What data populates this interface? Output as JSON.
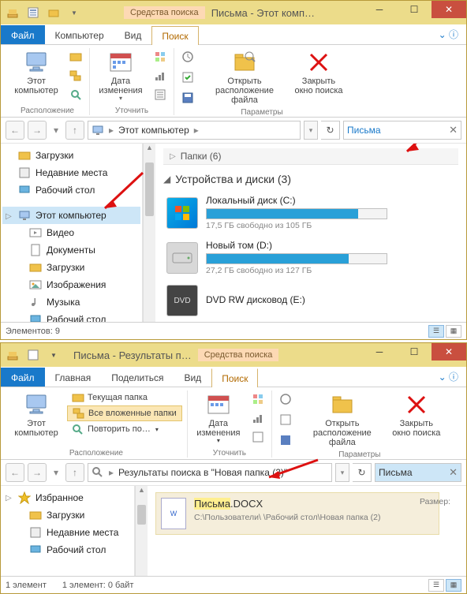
{
  "win1": {
    "context_tab": "Средства поиска",
    "title": "Письма - Этот комп…",
    "tabs": {
      "file": "Файл",
      "computer": "Компьютер",
      "view": "Вид",
      "search": "Поиск"
    },
    "ribbon": {
      "location": {
        "this_pc": "Этот\nкомпьютер",
        "group": "Расположение"
      },
      "refine": {
        "date": "Дата\nизменения",
        "group": "Уточнить"
      },
      "params": {
        "open": "Открыть\nрасположение файла",
        "close": "Закрыть\nокно поиска",
        "group": "Параметры"
      }
    },
    "crumb": {
      "root": "Этот компьютер"
    },
    "search": {
      "term": "Письма"
    },
    "tree": {
      "downloads": "Загрузки",
      "recent": "Недавние места",
      "desktop": "Рабочий стол",
      "this_pc": "Этот компьютер",
      "videos": "Видео",
      "documents": "Документы",
      "downloads2": "Загрузки",
      "images": "Изображения",
      "music": "Музыка",
      "desktop2": "Рабочий стол"
    },
    "folders_hdr": "Папки (6)",
    "devices_hdr": "Устройства и диски (3)",
    "drives": {
      "c": {
        "name": "Локальный диск (C:)",
        "free": "17,5 ГБ свободно из 105 ГБ",
        "pct": 84
      },
      "d": {
        "name": "Новый том (D:)",
        "free": "27,2 ГБ свободно из 127 ГБ",
        "pct": 79
      },
      "dvd": {
        "name": "DVD RW дисковод (E:)"
      }
    },
    "status": "Элементов: 9"
  },
  "win2": {
    "context_tab": "Средства поиска",
    "title": "Письма - Результаты п…",
    "tabs": {
      "file": "Файл",
      "home": "Главная",
      "share": "Поделиться",
      "view": "Вид",
      "search": "Поиск"
    },
    "ribbon": {
      "this_pc": "Этот\nкомпьютер",
      "current": "Текущая папка",
      "subfolders": "Все вложенные папки",
      "search_again": "Повторить по…",
      "group_loc": "Расположение",
      "date": "Дата\nизменения",
      "group_refine": "Уточнить",
      "open": "Открыть\nрасположение файла",
      "close": "Закрыть\nокно поиска",
      "group_params": "Параметры"
    },
    "crumb": "Результаты поиска в \"Новая папка (2)\"",
    "search_term": "Письма",
    "tree": {
      "fav": "Избранное",
      "downloads": "Загрузки",
      "recent": "Недавние места",
      "desktop": "Рабочий стол"
    },
    "result": {
      "hl": "Письма",
      "ext": ".DOCX",
      "size_label": "Размер:",
      "path": "C:\\Пользователи\\              \\Рабочий стол\\Новая папка (2)"
    },
    "status_left": "1 элемент",
    "status_right": "1 элемент: 0 байт"
  }
}
